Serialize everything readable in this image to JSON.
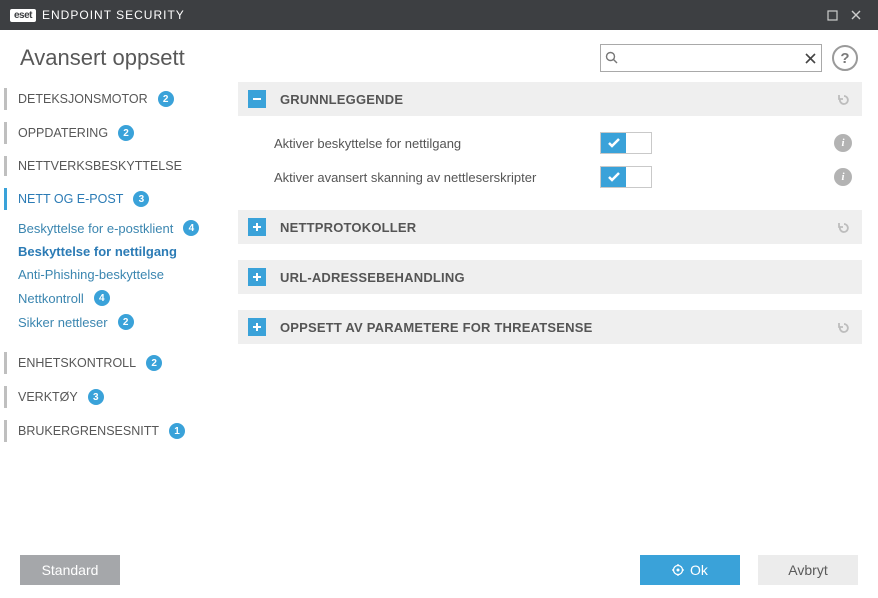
{
  "app": {
    "brand_badge": "eset",
    "brand_name": "ENDPOINT SECURITY"
  },
  "page_title": "Avansert oppsett",
  "search": {
    "placeholder": "",
    "value": ""
  },
  "help_label": "?",
  "sidebar": {
    "items": [
      {
        "label": "DETEKSJONSMOTOR",
        "count": "2"
      },
      {
        "label": "OPPDATERING",
        "count": "2"
      },
      {
        "label": "NETTVERKSBESKYTTELSE",
        "count": null
      },
      {
        "label": "NETT OG E-POST",
        "count": "3"
      },
      {
        "label": "ENHETSKONTROLL",
        "count": "2"
      },
      {
        "label": "VERKTØY",
        "count": "3"
      },
      {
        "label": "BRUKERGRENSESNITT",
        "count": "1"
      }
    ],
    "sub_items": [
      {
        "label": "Beskyttelse for e-postklient",
        "count": "4"
      },
      {
        "label": "Beskyttelse for nettilgang",
        "count": null,
        "selected": true
      },
      {
        "label": "Anti-Phishing-beskyttelse",
        "count": null
      },
      {
        "label": "Nettkontroll",
        "count": "4"
      },
      {
        "label": "Sikker nettleser",
        "count": "2"
      }
    ]
  },
  "sections": [
    {
      "title": "GRUNNLEGGENDE",
      "expanded": true,
      "settings": [
        {
          "label": "Aktiver beskyttelse for nettilgang",
          "on": true
        },
        {
          "label": "Aktiver avansert skanning av nettleserskripter",
          "on": true
        }
      ]
    },
    {
      "title": "NETTPROTOKOLLER",
      "expanded": false
    },
    {
      "title": "URL-ADRESSEBEHANDLING",
      "expanded": false
    },
    {
      "title": "OPPSETT AV PARAMETERE FOR THREATSENSE",
      "expanded": false
    }
  ],
  "footer": {
    "default_label": "Standard",
    "ok_label": "Ok",
    "cancel_label": "Avbryt"
  },
  "info_char": "i"
}
